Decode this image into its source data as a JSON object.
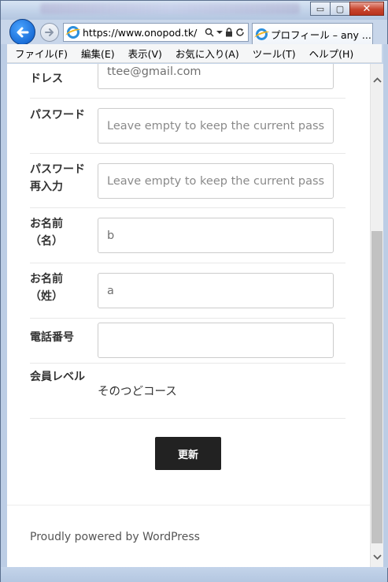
{
  "browser": {
    "title_buttons": {
      "minimize": "▭",
      "maximize": "▢",
      "close": "✕"
    },
    "url": "https://www.onopod.tk/",
    "tab_title": "プロフィール – any ...",
    "tab_close": "✕"
  },
  "menu": [
    "ファイル(F)",
    "編集(E)",
    "表示(V)",
    "お気に入り(A)",
    "ツール(T)",
    "ヘルプ(H)"
  ],
  "form": {
    "email": {
      "label": "ドレス",
      "value": "ttee@gmail.com"
    },
    "password": {
      "label": "パスワード",
      "placeholder": "Leave empty to keep the current pass"
    },
    "password_confirm": {
      "label": "パスワード再入力",
      "placeholder": "Leave empty to keep the current pass"
    },
    "first_name": {
      "label": "お名前（名）",
      "value": "b"
    },
    "last_name": {
      "label": "お名前（姓）",
      "value": "a"
    },
    "phone": {
      "label": "電話番号",
      "value": ""
    },
    "membership": {
      "label": "会員レベル",
      "value": "そのつどコース"
    },
    "submit": "更新"
  },
  "footer": {
    "text": "Proudly powered by WordPress"
  }
}
